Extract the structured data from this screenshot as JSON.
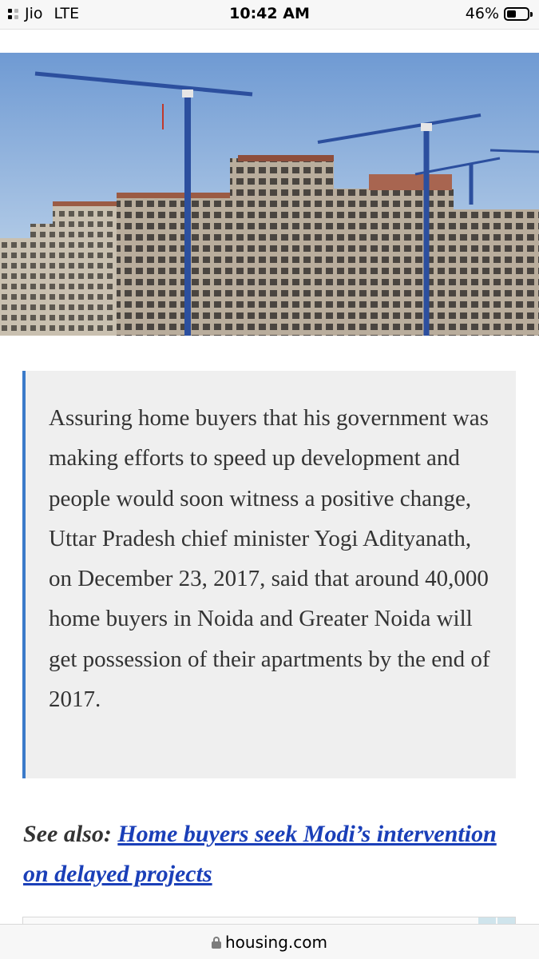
{
  "status_bar": {
    "carrier": "Jio",
    "network": "LTE",
    "time": "10:42 AM",
    "battery_percent": "46%",
    "battery_level": 0.46,
    "signal_bars": 2
  },
  "hero_image": {
    "subject": "high-rise residential towers under construction with tower cranes against blue sky",
    "colors": {
      "sky_top": "#6f9ad3",
      "sky_bottom": "#cfe0ef",
      "crane": "#2c4f9e",
      "concrete": "#b9ad9c"
    }
  },
  "article": {
    "blockquote": "Assuring home buyers that his government was making efforts to speed up development and people would soon witness a positive change, Uttar Pradesh chief minister Yogi Adityanath, on December 23, 2017, said that around 40,000 home buyers in Noida and Greater Noida will get possession of their apartments by the end of 2017.",
    "see_also_label": "See also:",
    "see_also_link": "Home buyers seek Modi’s intervention on delayed projects"
  },
  "browser": {
    "url": "housing.com"
  },
  "colors": {
    "quote_bar": "#3b7ac9",
    "quote_bg": "#efefef",
    "link": "#1a3fb8",
    "text": "#333333"
  }
}
